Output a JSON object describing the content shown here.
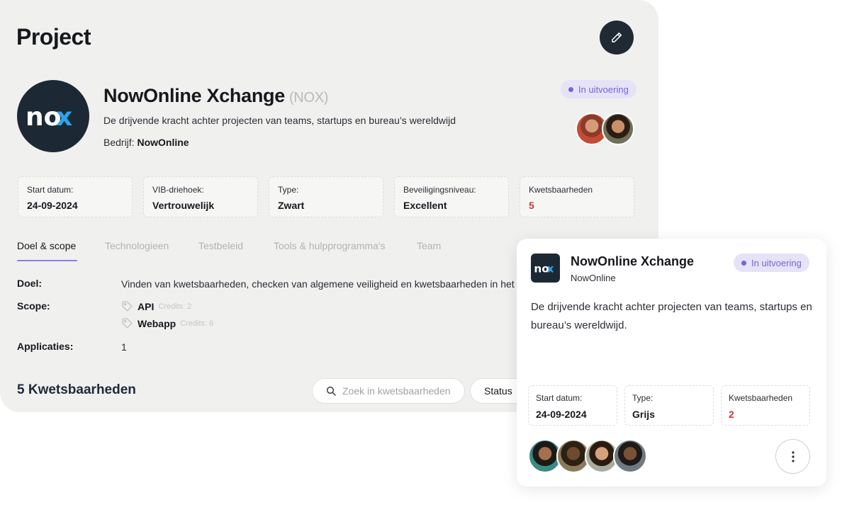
{
  "page": {
    "title": "Project"
  },
  "project": {
    "logo_text": "nox",
    "name": "NowOnline Xchange",
    "code": "(NOX)",
    "description": "De drijvende kracht achter projecten van teams, startups en bureau’s wereldwijd",
    "company_label": "Bedrijf:",
    "company": "NowOnline",
    "status": "In uitvoering",
    "info": [
      {
        "label": "Start datum:",
        "value": "24-09-2024"
      },
      {
        "label": "VIB-driehoek:",
        "value": "Vertrouwelijk"
      },
      {
        "label": "Type:",
        "value": "Zwart"
      },
      {
        "label": "Beveiligingsniveau:",
        "value": "Excellent"
      },
      {
        "label": "Kwetsbaarheden",
        "value": "5"
      }
    ]
  },
  "tabs": [
    {
      "label": "Doel & scope",
      "active": true
    },
    {
      "label": "Technologieen",
      "active": false
    },
    {
      "label": "Testbeleid",
      "active": false
    },
    {
      "label": "Tools & hulpprogramma's",
      "active": false
    },
    {
      "label": "Team",
      "active": false
    }
  ],
  "details": {
    "doel_label": "Doel:",
    "doel_value": "Vinden van kwetsbaarheden, checken van algemene veiligheid en kwetsbaarheden in het",
    "scope_label": "Scope:",
    "scope_items": [
      {
        "name": "API",
        "credits": "Credits: 2"
      },
      {
        "name": "Webapp",
        "credits": "Credits: 6"
      }
    ],
    "applicaties_label": "Applicaties:",
    "applicaties_value": "1"
  },
  "vulnerabilities": {
    "title": "5 Kwetsbaarheden",
    "search_placeholder": "Zoek in kwetsbaarheden",
    "status_filter": "Status"
  },
  "card": {
    "logo_text": "nox",
    "name": "NowOnline Xchange",
    "company": "NowOnline",
    "status": "In uitvoering",
    "description": "De drijvende kracht achter projecten van teams, startups en bureau’s wereldwijd.",
    "info": [
      {
        "label": "Start datum:",
        "value": "24-09-2024"
      },
      {
        "label": "Type:",
        "value": "Grijs"
      },
      {
        "label": "Kwetsbaarheden",
        "value": "2"
      }
    ]
  },
  "colors": {
    "accent": "#7764d4",
    "dark": "#1c2935",
    "danger": "#d6303a",
    "panel_bg": "#f0f0ef"
  },
  "icons": [
    "pencil-icon",
    "search-icon",
    "tag-icon",
    "more-vertical-icon"
  ]
}
